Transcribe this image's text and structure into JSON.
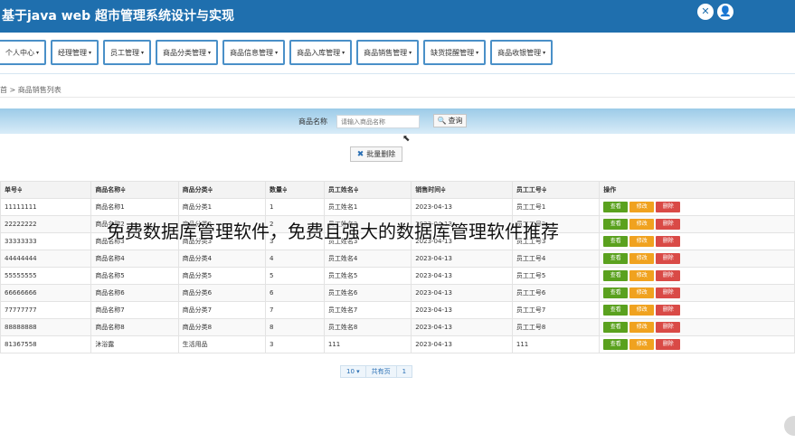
{
  "app": {
    "title": "基于java web 超市管理系统设计与实现",
    "icons": [
      "settings-icon",
      "user-icon"
    ]
  },
  "menu": [
    "个人中心",
    "经理管理",
    "员工管理",
    "商品分类管理",
    "商品信息管理",
    "商品入库管理",
    "商品销售管理",
    "缺货提醒管理",
    "商品收银管理"
  ],
  "breadcrumb": "首 > 商品销售列表",
  "search": {
    "label": "商品名称",
    "placeholder": "请输入商品名称",
    "button": "查询"
  },
  "batch_delete": "批量删除",
  "table": {
    "headers": [
      "单号≑",
      "商品名称≑",
      "商品分类≑",
      "数量≑",
      "员工姓名≑",
      "销售时间≑",
      "员工工号≑",
      "操作"
    ],
    "rows": [
      [
        "11111111",
        "商品名称1",
        "商品分类1",
        "1",
        "员工姓名1",
        "2023-04-13",
        "员工工号1"
      ],
      [
        "22222222",
        "商品名称2",
        "商品分类2",
        "2",
        "员工姓名2",
        "2023-04-13",
        "员工工号2"
      ],
      [
        "33333333",
        "商品名称3",
        "商品分类3",
        "3",
        "员工姓名3",
        "2023-04-13",
        "员工工号3"
      ],
      [
        "44444444",
        "商品名称4",
        "商品分类4",
        "4",
        "员工姓名4",
        "2023-04-13",
        "员工工号4"
      ],
      [
        "55555555",
        "商品名称5",
        "商品分类5",
        "5",
        "员工姓名5",
        "2023-04-13",
        "员工工号5"
      ],
      [
        "66666666",
        "商品名称6",
        "商品分类6",
        "6",
        "员工姓名6",
        "2023-04-13",
        "员工工号6"
      ],
      [
        "77777777",
        "商品名称7",
        "商品分类7",
        "7",
        "员工姓名7",
        "2023-04-13",
        "员工工号7"
      ],
      [
        "88888888",
        "商品名称8",
        "商品分类8",
        "8",
        "员工姓名8",
        "2023-04-13",
        "员工工号8"
      ],
      [
        "81367558",
        "沐浴露",
        "生活用品",
        "3",
        "111",
        "2023-04-13",
        "111"
      ]
    ],
    "actions": {
      "view": "查看",
      "edit": "修改",
      "delete": "删除"
    }
  },
  "pager": {
    "page_size": "10",
    "total": "共有页",
    "page": "1"
  },
  "watermark": "免费数据库管理软件，免费且强大的数据库管理软件推荐",
  "colors": {
    "header": "#1f6fae",
    "view": "#5aa11e",
    "edit": "#f0a21f",
    "delete": "#d94a46"
  }
}
